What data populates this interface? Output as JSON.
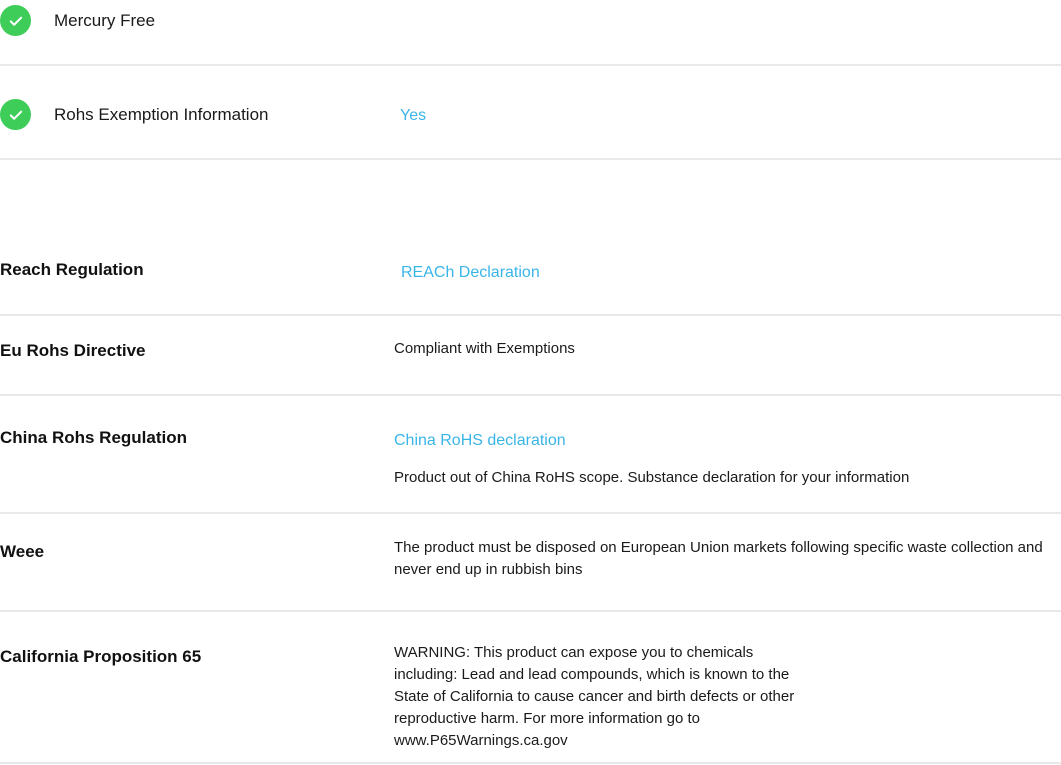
{
  "features": [
    {
      "label": "Mercury Free",
      "value": ""
    },
    {
      "label": "Rohs Exemption Information",
      "value": "Yes"
    }
  ],
  "regulations": {
    "reach": {
      "label": "Reach Regulation",
      "link": "REACh Declaration"
    },
    "eu_rohs": {
      "label": "Eu Rohs Directive",
      "text": "Compliant with Exemptions"
    },
    "china_rohs": {
      "label": "China Rohs Regulation",
      "link": "China RoHS declaration",
      "text": "Product out of China RoHS scope. Substance declaration for your information"
    },
    "weee": {
      "label": "Weee",
      "text": "The product must be disposed on European Union markets following specific waste collection and never end up in rubbish bins"
    },
    "ca_prop65": {
      "label": "California Proposition 65",
      "text": "WARNING: This product can expose you to chemicals including: Lead and lead compounds, which is known to the State of California to cause cancer and birth defects or other reproductive harm. For more information go to www.P65Warnings.ca.gov"
    }
  },
  "colors": {
    "check": "#3dcd58",
    "link": "#3ab5e8",
    "divider": "#e9e9e9"
  }
}
